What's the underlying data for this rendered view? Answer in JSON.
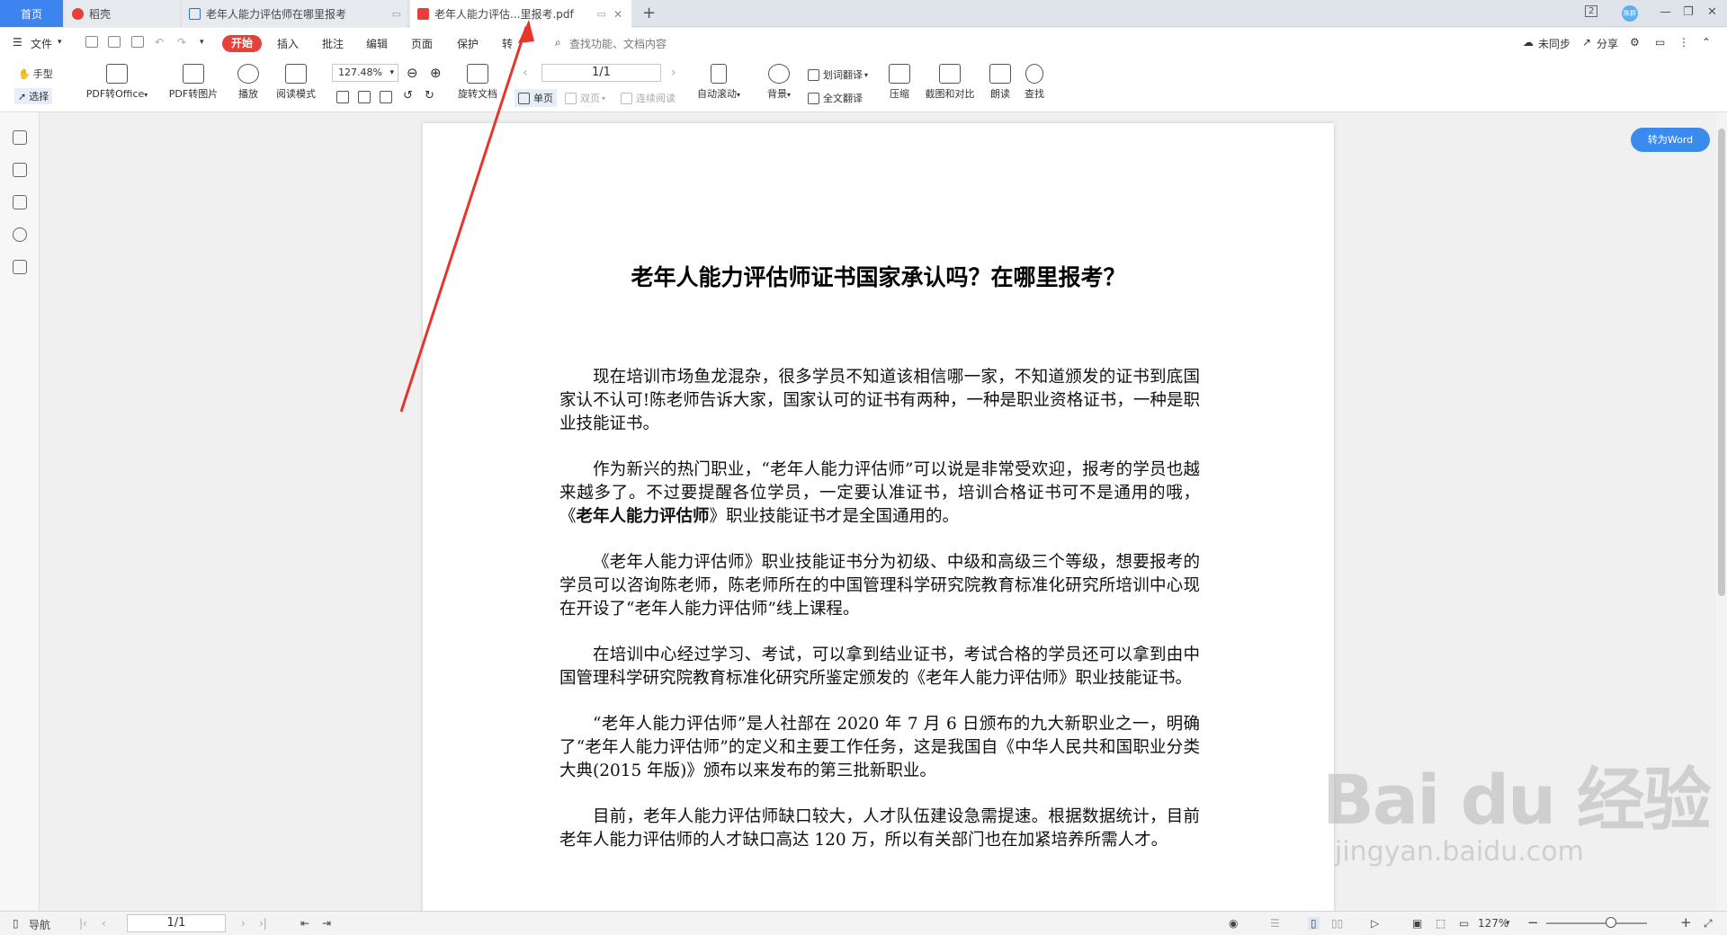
{
  "tabs": {
    "home": "首页",
    "daoke": "稻壳",
    "doc": "老年人能力评估师在哪里报考",
    "pdf": "老年人能力评估...里报考.pdf",
    "add": "+",
    "close": "✕"
  },
  "window": {
    "badge": "2",
    "avatar": "陈群",
    "minimize": "—",
    "restore": "❐",
    "close": "✕"
  },
  "menu": {
    "file": "文件",
    "start": "开始",
    "insert": "插入",
    "annotate": "批注",
    "edit": "编辑",
    "page": "页面",
    "protect": "保护",
    "convert": "转",
    "search": "查找功能、文档内容",
    "unsync": "未同步",
    "share": "分享"
  },
  "toolbar": {
    "hand": "手型",
    "select": "选择",
    "pdf_office": "PDF转Office",
    "pdf_image": "PDF转图片",
    "play": "播放",
    "read_mode": "阅读模式",
    "zoom": "127.48%",
    "rotate": "旋转文档",
    "single": "单页",
    "double": "双页",
    "continuous": "连续阅读",
    "page_value": "1/1",
    "auto_scroll": "自动滚动",
    "background": "背景",
    "word_translate": "划词翻译",
    "full_translate": "全文翻译",
    "compress": "压缩",
    "screenshot": "截图和对比",
    "read_aloud": "朗读",
    "find": "查找"
  },
  "convert_word": "转为Word",
  "document": {
    "title": "老年人能力评估师证书国家承认吗？在哪里报考？",
    "p1": "现在培训市场鱼龙混杂，很多学员不知道该相信哪一家，不知道颁发的证书到底国家认不认可!陈老师告诉大家，国家认可的证书有两种，一种是职业资格证书，一种是职业技能证书。",
    "p2a": "作为新兴的热门职业，“老年人能力评估师”可以说是非常受欢迎，报考的学员也越来越多了。不过要提醒各位学员，一定要认准证书，培训合格证书可不是通用的哦，《",
    "p2b": "老年人能力评估师",
    "p2c": "》职业技能证书才是全国通用的。",
    "p3": "《老年人能力评估师》职业技能证书分为初级、中级和高级三个等级，想要报考的学员可以咨询陈老师，陈老师所在的中国管理科学研究院教育标准化研究所培训中心现在开设了“老年人能力评估师”线上课程。",
    "p4": "在培训中心经过学习、考试，可以拿到结业证书，考试合格的学员还可以拿到由中国管理科学研究院教育标准化研究所鉴定颁发的《老年人能力评估师》职业技能证书。",
    "p5": "“老年人能力评估师”是人社部在 2020 年 7 月 6 日颁布的九大新职业之一，明确了“老年人能力评估师”的定义和主要工作任务，这是我国自《中华人民共和国职业分类大典(2015 年版)》颁布以来发布的第三批新职业。",
    "p6": "目前，老年人能力评估师缺口较大，人才队伍建设急需提速。根据数据统计，目前老年人能力评估师的人才缺口高达 120 万，所以有关部门也在加紧培养所需人才。"
  },
  "watermark": {
    "main": "Bai du 经验",
    "sub": "jingyan.baidu.com"
  },
  "status": {
    "nav": "导航",
    "page": "1/1",
    "zoom": "127%",
    "minus": "−",
    "plus": "+"
  },
  "colors": {
    "accent": "#3d84f0",
    "start": "#e5403a",
    "arrow": "#e8352b"
  }
}
